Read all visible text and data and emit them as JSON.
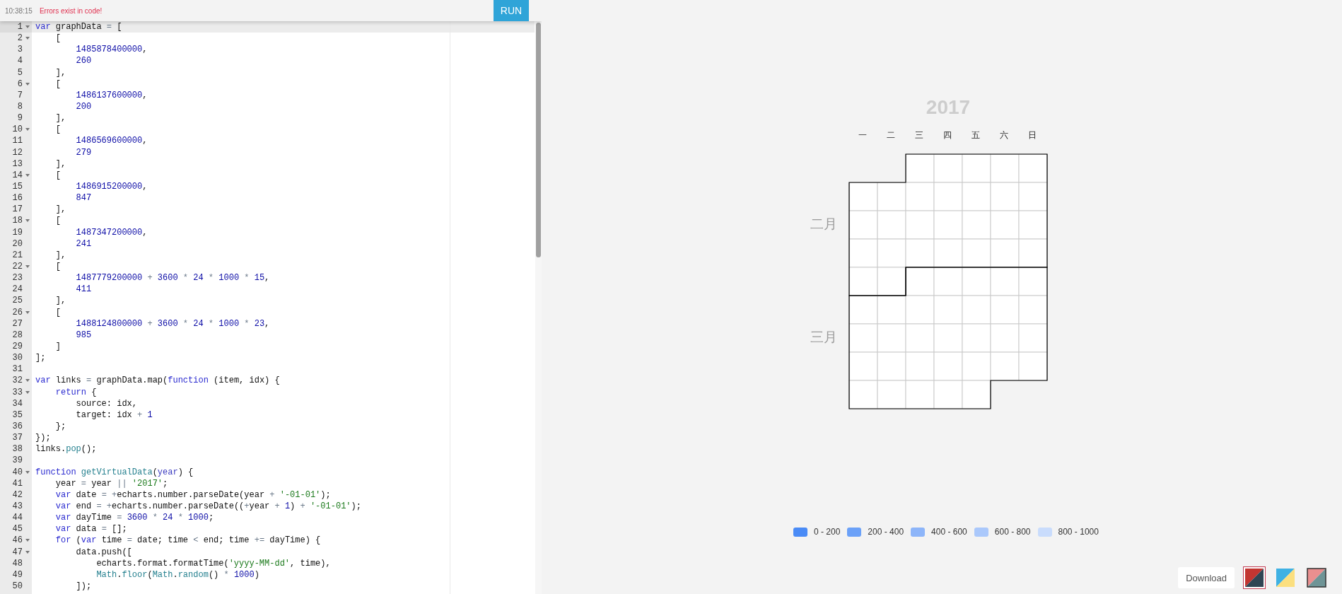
{
  "toolbar": {
    "time": "10:38:15",
    "message": "Errors exist in code!",
    "run_button": "RUN"
  },
  "editor": {
    "lines": [
      {
        "number": "1",
        "foldable": true,
        "current": true,
        "tokens": [
          {
            "kind": "keyword",
            "text": "var"
          },
          {
            "kind": "plain",
            "text": " graphData "
          },
          {
            "kind": "operator",
            "text": "="
          },
          {
            "kind": "plain",
            "text": " ["
          }
        ]
      },
      {
        "number": "2",
        "foldable": true,
        "current": false,
        "tokens": [
          {
            "kind": "plain",
            "text": "    ["
          }
        ]
      },
      {
        "number": "3",
        "foldable": false,
        "current": false,
        "tokens": [
          {
            "kind": "number",
            "text": "        1485878400000"
          },
          {
            "kind": "plain",
            "text": ","
          }
        ]
      },
      {
        "number": "4",
        "foldable": false,
        "current": false,
        "tokens": [
          {
            "kind": "number",
            "text": "        260"
          }
        ]
      },
      {
        "number": "5",
        "foldable": false,
        "current": false,
        "tokens": [
          {
            "kind": "plain",
            "text": "    ],"
          }
        ]
      },
      {
        "number": "6",
        "foldable": true,
        "current": false,
        "tokens": [
          {
            "kind": "plain",
            "text": "    ["
          }
        ]
      },
      {
        "number": "7",
        "foldable": false,
        "current": false,
        "tokens": [
          {
            "kind": "number",
            "text": "        1486137600000"
          },
          {
            "kind": "plain",
            "text": ","
          }
        ]
      },
      {
        "number": "8",
        "foldable": false,
        "current": false,
        "tokens": [
          {
            "kind": "number",
            "text": "        200"
          }
        ]
      },
      {
        "number": "9",
        "foldable": false,
        "current": false,
        "tokens": [
          {
            "kind": "plain",
            "text": "    ],"
          }
        ]
      },
      {
        "number": "10",
        "foldable": true,
        "current": false,
        "tokens": [
          {
            "kind": "plain",
            "text": "    ["
          }
        ]
      },
      {
        "number": "11",
        "foldable": false,
        "current": false,
        "tokens": [
          {
            "kind": "number",
            "text": "        1486569600000"
          },
          {
            "kind": "plain",
            "text": ","
          }
        ]
      },
      {
        "number": "12",
        "foldable": false,
        "current": false,
        "tokens": [
          {
            "kind": "number",
            "text": "        279"
          }
        ]
      },
      {
        "number": "13",
        "foldable": false,
        "current": false,
        "tokens": [
          {
            "kind": "plain",
            "text": "    ],"
          }
        ]
      },
      {
        "number": "14",
        "foldable": true,
        "current": false,
        "tokens": [
          {
            "kind": "plain",
            "text": "    ["
          }
        ]
      },
      {
        "number": "15",
        "foldable": false,
        "current": false,
        "tokens": [
          {
            "kind": "number",
            "text": "        1486915200000"
          },
          {
            "kind": "plain",
            "text": ","
          }
        ]
      },
      {
        "number": "16",
        "foldable": false,
        "current": false,
        "tokens": [
          {
            "kind": "number",
            "text": "        847"
          }
        ]
      },
      {
        "number": "17",
        "foldable": false,
        "current": false,
        "tokens": [
          {
            "kind": "plain",
            "text": "    ],"
          }
        ]
      },
      {
        "number": "18",
        "foldable": true,
        "current": false,
        "tokens": [
          {
            "kind": "plain",
            "text": "    ["
          }
        ]
      },
      {
        "number": "19",
        "foldable": false,
        "current": false,
        "tokens": [
          {
            "kind": "number",
            "text": "        1487347200000"
          },
          {
            "kind": "plain",
            "text": ","
          }
        ]
      },
      {
        "number": "20",
        "foldable": false,
        "current": false,
        "tokens": [
          {
            "kind": "number",
            "text": "        241"
          }
        ]
      },
      {
        "number": "21",
        "foldable": false,
        "current": false,
        "tokens": [
          {
            "kind": "plain",
            "text": "    ],"
          }
        ]
      },
      {
        "number": "22",
        "foldable": true,
        "current": false,
        "tokens": [
          {
            "kind": "plain",
            "text": "    ["
          }
        ]
      },
      {
        "number": "23",
        "foldable": false,
        "current": false,
        "tokens": [
          {
            "kind": "number",
            "text": "        1487779200000"
          },
          {
            "kind": "operator",
            "text": " + "
          },
          {
            "kind": "number",
            "text": "3600"
          },
          {
            "kind": "operator",
            "text": " * "
          },
          {
            "kind": "number",
            "text": "24"
          },
          {
            "kind": "operator",
            "text": " * "
          },
          {
            "kind": "number",
            "text": "1000"
          },
          {
            "kind": "operator",
            "text": " * "
          },
          {
            "kind": "number",
            "text": "15"
          },
          {
            "kind": "plain",
            "text": ","
          }
        ]
      },
      {
        "number": "24",
        "foldable": false,
        "current": false,
        "tokens": [
          {
            "kind": "number",
            "text": "        411"
          }
        ]
      },
      {
        "number": "25",
        "foldable": false,
        "current": false,
        "tokens": [
          {
            "kind": "plain",
            "text": "    ],"
          }
        ]
      },
      {
        "number": "26",
        "foldable": true,
        "current": false,
        "tokens": [
          {
            "kind": "plain",
            "text": "    ["
          }
        ]
      },
      {
        "number": "27",
        "foldable": false,
        "current": false,
        "tokens": [
          {
            "kind": "number",
            "text": "        1488124800000"
          },
          {
            "kind": "operator",
            "text": " + "
          },
          {
            "kind": "number",
            "text": "3600"
          },
          {
            "kind": "operator",
            "text": " * "
          },
          {
            "kind": "number",
            "text": "24"
          },
          {
            "kind": "operator",
            "text": " * "
          },
          {
            "kind": "number",
            "text": "1000"
          },
          {
            "kind": "operator",
            "text": " * "
          },
          {
            "kind": "number",
            "text": "23"
          },
          {
            "kind": "plain",
            "text": ","
          }
        ]
      },
      {
        "number": "28",
        "foldable": false,
        "current": false,
        "tokens": [
          {
            "kind": "number",
            "text": "        985"
          }
        ]
      },
      {
        "number": "29",
        "foldable": false,
        "current": false,
        "tokens": [
          {
            "kind": "plain",
            "text": "    ]"
          }
        ]
      },
      {
        "number": "30",
        "foldable": false,
        "current": false,
        "tokens": [
          {
            "kind": "plain",
            "text": "];"
          }
        ]
      },
      {
        "number": "31",
        "foldable": false,
        "current": false
      },
      {
        "number": "32",
        "foldable": true,
        "current": false,
        "tokens": [
          {
            "kind": "keyword",
            "text": "var"
          },
          {
            "kind": "plain",
            "text": " links "
          },
          {
            "kind": "operator",
            "text": "="
          },
          {
            "kind": "plain",
            "text": " graphData.map("
          },
          {
            "kind": "keyword",
            "text": "function"
          },
          {
            "kind": "plain",
            "text": " (item, idx) {"
          }
        ]
      },
      {
        "number": "33",
        "foldable": true,
        "current": false,
        "tokens": [
          {
            "kind": "keyword",
            "text": "    return"
          },
          {
            "kind": "plain",
            "text": " {"
          }
        ]
      },
      {
        "number": "34",
        "foldable": false,
        "current": false,
        "tokens": [
          {
            "kind": "plain",
            "text": "        source: idx,"
          }
        ]
      },
      {
        "number": "35",
        "foldable": false,
        "current": false,
        "tokens": [
          {
            "kind": "plain",
            "text": "        target: idx "
          },
          {
            "kind": "operator",
            "text": "+"
          },
          {
            "kind": "number",
            "text": " 1"
          }
        ]
      },
      {
        "number": "36",
        "foldable": false,
        "current": false,
        "tokens": [
          {
            "kind": "plain",
            "text": "    };"
          }
        ]
      },
      {
        "number": "37",
        "foldable": false,
        "current": false,
        "tokens": [
          {
            "kind": "plain",
            "text": "});"
          }
        ]
      },
      {
        "number": "38",
        "foldable": false,
        "current": false,
        "tokens": [
          {
            "kind": "plain",
            "text": "links."
          },
          {
            "kind": "support",
            "text": "pop"
          },
          {
            "kind": "plain",
            "text": "();"
          }
        ]
      },
      {
        "number": "39",
        "foldable": false,
        "current": false
      },
      {
        "number": "40",
        "foldable": true,
        "current": false,
        "tokens": [
          {
            "kind": "keyword",
            "text": "function"
          },
          {
            "kind": "support",
            "text": " getVirtualData"
          },
          {
            "kind": "plain",
            "text": "("
          },
          {
            "kind": "param",
            "text": "year"
          },
          {
            "kind": "plain",
            "text": ") {"
          }
        ]
      },
      {
        "number": "41",
        "foldable": false,
        "current": false,
        "tokens": [
          {
            "kind": "plain",
            "text": "    year "
          },
          {
            "kind": "operator",
            "text": "="
          },
          {
            "kind": "plain",
            "text": " year "
          },
          {
            "kind": "operator",
            "text": "||"
          },
          {
            "kind": "string",
            "text": " '2017'"
          },
          {
            "kind": "plain",
            "text": ";"
          }
        ]
      },
      {
        "number": "42",
        "foldable": false,
        "current": false,
        "tokens": [
          {
            "kind": "keyword",
            "text": "    var"
          },
          {
            "kind": "plain",
            "text": " date "
          },
          {
            "kind": "operator",
            "text": "="
          },
          {
            "kind": "operator",
            "text": " +"
          },
          {
            "kind": "plain",
            "text": "echarts.number.parseDate(year "
          },
          {
            "kind": "operator",
            "text": "+"
          },
          {
            "kind": "string",
            "text": " '-01-01'"
          },
          {
            "kind": "plain",
            "text": ");"
          }
        ]
      },
      {
        "number": "43",
        "foldable": false,
        "current": false,
        "tokens": [
          {
            "kind": "keyword",
            "text": "    var"
          },
          {
            "kind": "plain",
            "text": " end "
          },
          {
            "kind": "operator",
            "text": "="
          },
          {
            "kind": "operator",
            "text": " +"
          },
          {
            "kind": "plain",
            "text": "echarts.number.parseDate(("
          },
          {
            "kind": "operator",
            "text": "+"
          },
          {
            "kind": "plain",
            "text": "year "
          },
          {
            "kind": "operator",
            "text": "+"
          },
          {
            "kind": "number",
            "text": " 1"
          },
          {
            "kind": "plain",
            "text": ") "
          },
          {
            "kind": "operator",
            "text": "+"
          },
          {
            "kind": "string",
            "text": " '-01-01'"
          },
          {
            "kind": "plain",
            "text": ");"
          }
        ]
      },
      {
        "number": "44",
        "foldable": false,
        "current": false,
        "tokens": [
          {
            "kind": "keyword",
            "text": "    var"
          },
          {
            "kind": "plain",
            "text": " dayTime "
          },
          {
            "kind": "operator",
            "text": "="
          },
          {
            "kind": "number",
            "text": " 3600"
          },
          {
            "kind": "operator",
            "text": " * "
          },
          {
            "kind": "number",
            "text": "24"
          },
          {
            "kind": "operator",
            "text": " * "
          },
          {
            "kind": "number",
            "text": "1000"
          },
          {
            "kind": "plain",
            "text": ";"
          }
        ]
      },
      {
        "number": "45",
        "foldable": false,
        "current": false,
        "tokens": [
          {
            "kind": "keyword",
            "text": "    var"
          },
          {
            "kind": "plain",
            "text": " data "
          },
          {
            "kind": "operator",
            "text": "="
          },
          {
            "kind": "plain",
            "text": " [];"
          }
        ]
      },
      {
        "number": "46",
        "foldable": true,
        "current": false,
        "tokens": [
          {
            "kind": "keyword",
            "text": "    for"
          },
          {
            "kind": "plain",
            "text": " ("
          },
          {
            "kind": "keyword",
            "text": "var"
          },
          {
            "kind": "plain",
            "text": " time "
          },
          {
            "kind": "operator",
            "text": "="
          },
          {
            "kind": "plain",
            "text": " date; time "
          },
          {
            "kind": "operator",
            "text": "<"
          },
          {
            "kind": "plain",
            "text": " end; time "
          },
          {
            "kind": "operator",
            "text": "+="
          },
          {
            "kind": "plain",
            "text": " dayTime) {"
          }
        ]
      },
      {
        "number": "47",
        "foldable": true,
        "current": false,
        "tokens": [
          {
            "kind": "plain",
            "text": "        data.push(["
          }
        ]
      },
      {
        "number": "48",
        "foldable": false,
        "current": false,
        "tokens": [
          {
            "kind": "plain",
            "text": "            echarts.format.formatTime("
          },
          {
            "kind": "string",
            "text": "'yyyy-MM-dd'"
          },
          {
            "kind": "plain",
            "text": ", time),"
          }
        ]
      },
      {
        "number": "49",
        "foldable": false,
        "current": false,
        "tokens": [
          {
            "kind": "support",
            "text": "            Math"
          },
          {
            "kind": "plain",
            "text": "."
          },
          {
            "kind": "support",
            "text": "floor"
          },
          {
            "kind": "plain",
            "text": "("
          },
          {
            "kind": "support",
            "text": "Math"
          },
          {
            "kind": "plain",
            "text": "."
          },
          {
            "kind": "support",
            "text": "random"
          },
          {
            "kind": "plain",
            "text": "() "
          },
          {
            "kind": "operator",
            "text": "*"
          },
          {
            "kind": "number",
            "text": " 1000"
          },
          {
            "kind": "plain",
            "text": ")"
          }
        ]
      },
      {
        "number": "50",
        "foldable": false,
        "current": false,
        "tokens": [
          {
            "kind": "plain",
            "text": "        ]);"
          }
        ]
      }
    ]
  },
  "chart": {
    "title": "2017",
    "weekdays": [
      "一",
      "二",
      "三",
      "四",
      "五",
      "六",
      "日"
    ],
    "months": [
      "二月",
      "三月"
    ],
    "legend": [
      {
        "label": "0 - 200",
        "color": "#4a8bf6"
      },
      {
        "label": "200 - 400",
        "color": "#6ba1f8"
      },
      {
        "label": "400 - 600",
        "color": "#8db5f9"
      },
      {
        "label": "600 - 800",
        "color": "#aac8fb"
      },
      {
        "label": "800 - 1000",
        "color": "#c9dcfc"
      }
    ]
  },
  "download_button": "Download",
  "themes": [
    {
      "selected": true,
      "halves": [
        {
          "color": "#c23531"
        },
        {
          "color": "#2f4554"
        }
      ]
    },
    {
      "selected": false,
      "halves": [
        {
          "color": "#3fb1e3"
        },
        {
          "color": "#fbdf7f"
        }
      ]
    },
    {
      "selected": false,
      "halves": [
        {
          "color": "#e98f8f"
        },
        {
          "color": "#6e9496"
        }
      ]
    }
  ]
}
